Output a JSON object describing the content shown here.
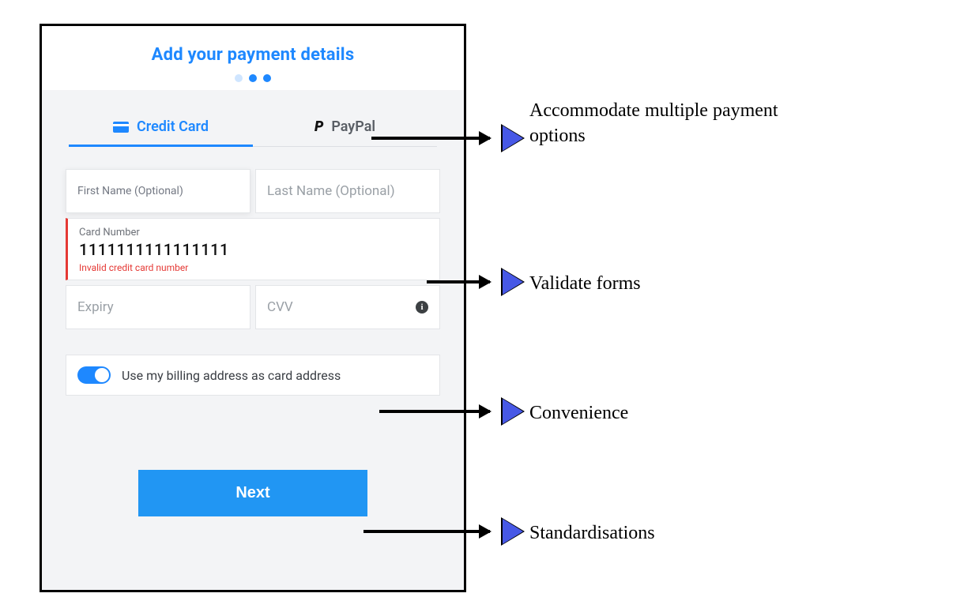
{
  "header": {
    "title": "Add your payment details"
  },
  "tabs": {
    "credit_card": "Credit Card",
    "paypal": "PayPal"
  },
  "form": {
    "first_name_placeholder": "First Name (Optional)",
    "last_name_placeholder": "Last Name (Optional)",
    "card_number_label": "Card Number",
    "card_number_value": "1111111111111111",
    "card_number_error": "Invalid credit card number",
    "expiry_placeholder": "Expiry",
    "cvv_placeholder": "CVV"
  },
  "toggle": {
    "label": "Use my billing address as card address",
    "on": true
  },
  "action": {
    "next_label": "Next"
  },
  "annotations": {
    "a1": "Accommodate multiple payment options",
    "a2": "Validate forms",
    "a3": "Convenience",
    "a4": "Standardisations"
  }
}
